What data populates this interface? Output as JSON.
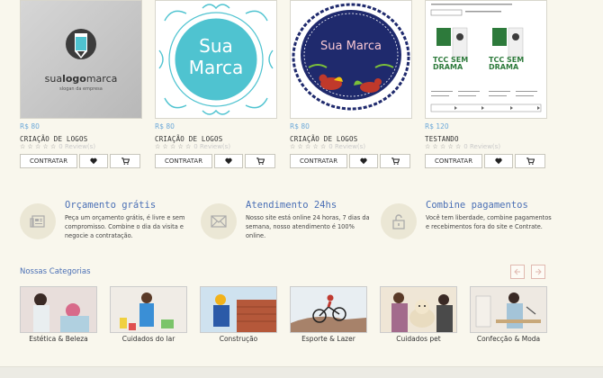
{
  "products": [
    {
      "price": "R$ 80",
      "name": "CRIAÇÃO DE LOGOS",
      "stars": "☆ ☆ ☆ ☆ ☆",
      "reviews": "0 Review(s)",
      "buy": "CONTRATAR",
      "logo_text": "sua",
      "logo_bold": "logo",
      "logo_end": "marca",
      "logo_sub": "slogan da empresa"
    },
    {
      "price": "R$ 80",
      "name": "CRIAÇÃO DE LOGOS",
      "stars": "☆ ☆ ☆ ☆ ☆",
      "reviews": "0 Review(s)",
      "buy": "CONTRATAR",
      "frame_line1": "Sua",
      "frame_line2": "Marca"
    },
    {
      "price": "R$ 80",
      "name": "CRIAÇÃO DE LOGOS",
      "stars": "☆ ☆ ☆ ☆ ☆",
      "reviews": "0 Review(s)",
      "buy": "CONTRATAR",
      "oval_text": "Sua Marca"
    },
    {
      "price": "R$ 120",
      "name": "TESTANDO",
      "stars": "☆ ☆ ☆ ☆ ☆",
      "reviews": "0 Review(s)",
      "buy": "CONTRATAR",
      "poster_label": "TCC SEM DRAMA"
    }
  ],
  "features": [
    {
      "title": "Orçamento grátis",
      "text": "Peça um orçamento grátis, é livre e sem compromisso. Combine o dia da visita e negocie a contratação.",
      "icon": "newspaper-icon"
    },
    {
      "title": "Atendimento 24hs",
      "text": "Nosso site está online 24 horas, 7 dias da semana, nosso atendimento é 100% online.",
      "icon": "envelope-icon"
    },
    {
      "title": "Combine pagamentos",
      "text": "Você tem liberdade, combine pagamentos e recebimentos fora do site e Contrate.",
      "icon": "unlock-icon"
    }
  ],
  "categories_title": "Nossas Categorias",
  "categories": [
    {
      "label": "Estética & Beleza"
    },
    {
      "label": "Cuidados do lar"
    },
    {
      "label": "Construção"
    },
    {
      "label": "Esporte & Lazer"
    },
    {
      "label": "Cuidados pet"
    },
    {
      "label": "Confecção & Moda"
    }
  ],
  "colors": {
    "accent": "#4a6fb5",
    "price": "#6aa7d8",
    "teal": "#4fc3d0",
    "navy": "#1f2a6d",
    "background": "#f9f7ed"
  }
}
